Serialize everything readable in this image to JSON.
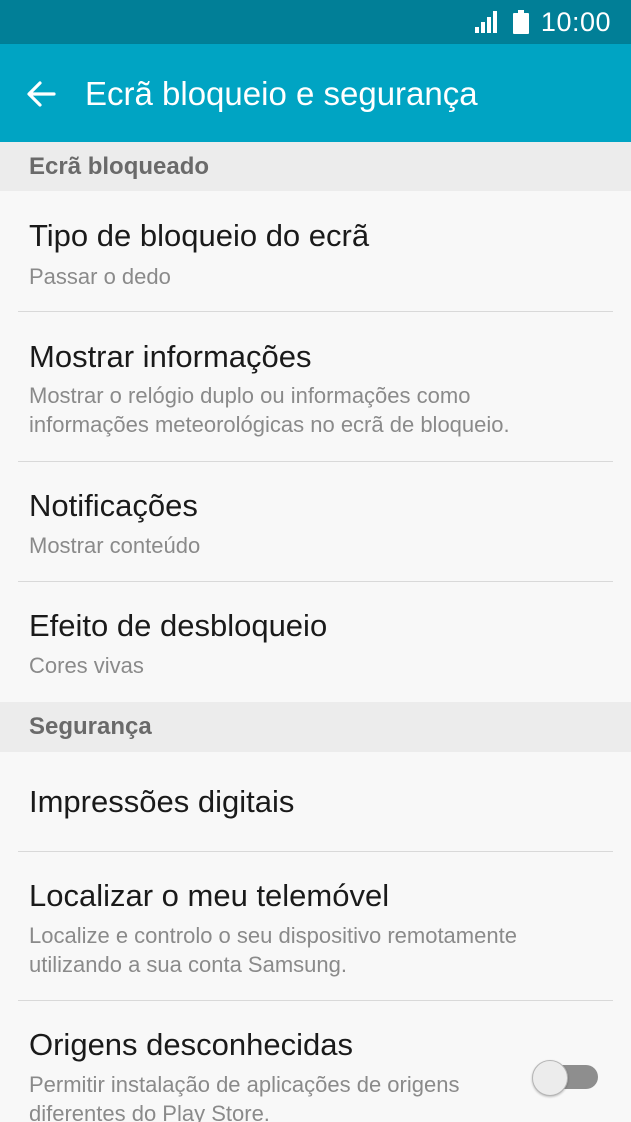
{
  "status_bar": {
    "time": "10:00",
    "icons": [
      "signal-icon",
      "battery-icon"
    ]
  },
  "header": {
    "title": "Ecrã bloqueio e segurança",
    "back_icon": "arrow-left-icon"
  },
  "sections": [
    {
      "header": "Ecrã bloqueado",
      "items": [
        {
          "title": "Tipo de bloqueio do ecrã",
          "subtitle": "Passar o dedo"
        },
        {
          "title": "Mostrar informações",
          "subtitle": "Mostrar o relógio duplo ou informações como informações meteorológicas no ecrã de bloqueio."
        },
        {
          "title": "Notificações",
          "subtitle": "Mostrar conteúdo"
        },
        {
          "title": "Efeito de desbloqueio",
          "subtitle": "Cores vivas"
        }
      ]
    },
    {
      "header": "Segurança",
      "items": [
        {
          "title": "Impressões digitais"
        },
        {
          "title": "Localizar o meu telemóvel",
          "subtitle": "Localize e controlo o seu dispositivo remotamente utilizando a sua conta Samsung."
        },
        {
          "title": "Origens desconhecidas",
          "subtitle": "Permitir instalação de aplicações de origens diferentes do Play Store.",
          "toggle_on": false
        }
      ]
    }
  ],
  "colors": {
    "status_bar": "#017f97",
    "app_bar": "#00a4c3",
    "section_header_bg": "#ececec",
    "background": "#f8f8f8"
  }
}
